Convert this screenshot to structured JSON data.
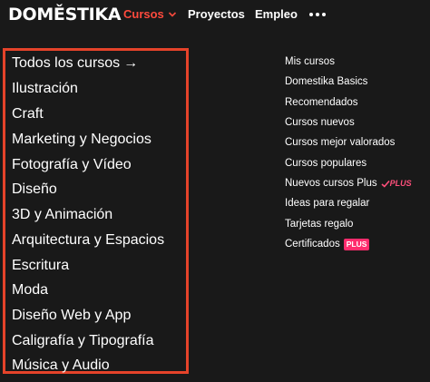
{
  "header": {
    "logo": "DOMĚSTIKA",
    "nav": {
      "cursos": "Cursos",
      "proyectos": "Proyectos",
      "empleo": "Empleo"
    }
  },
  "categories": {
    "all_courses": "Todos los cursos",
    "all_courses_arrow": "→",
    "items": [
      "Ilustración",
      "Craft",
      "Marketing y Negocios",
      "Fotografía y Vídeo",
      "Diseño",
      "3D y Animación",
      "Arquitectura y Espacios",
      "Escritura",
      "Moda",
      "Diseño Web y App",
      "Caligrafía y Tipografía",
      "Música y Audio"
    ]
  },
  "side_menu": {
    "items": [
      "Mis cursos",
      "Domestika Basics",
      "Recomendados",
      "Cursos nuevos",
      "Cursos mejor valorados",
      "Cursos populares",
      "Nuevos cursos Plus",
      "Ideas para regalar",
      "Tarjetas regalo",
      "Certificados"
    ],
    "plus_tag": "PLUS",
    "plus_badge": "PLUS"
  },
  "colors": {
    "background": "#191919",
    "accent": "#ff4a3d",
    "highlight_border": "#e5432a",
    "plus": "#ff2c6d"
  }
}
